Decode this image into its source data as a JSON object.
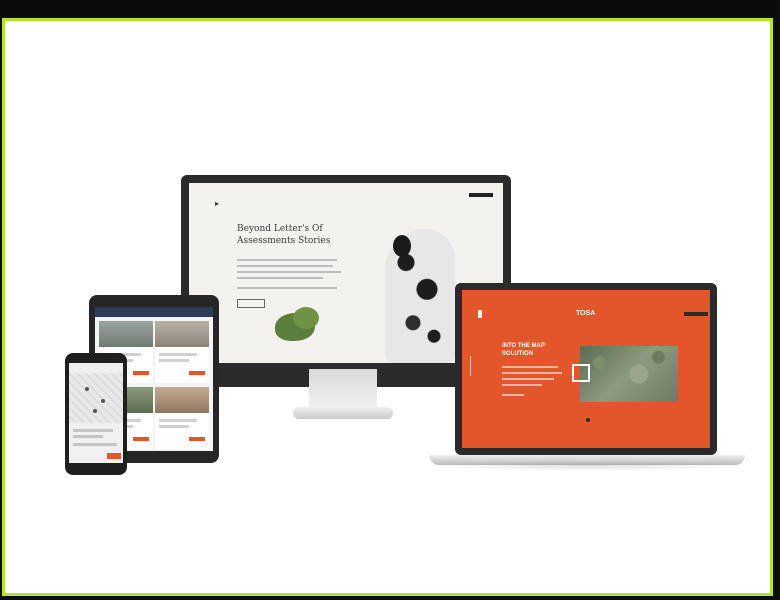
{
  "frame": {
    "border_color": "#b6e233",
    "background": "#ffffff",
    "page_background": "#0b0b0b"
  },
  "devices": {
    "monitor": {
      "headline": "Beyond Letter's Of Assessments Stories",
      "accent": "#e3562c"
    },
    "laptop": {
      "brand": "TOSA",
      "headline": "INTO THE MAP SOLUTION",
      "accent": "#e3562c"
    },
    "tablet": {
      "header_color": "#2c3e57"
    },
    "phone": {
      "button_color": "#e3562c"
    }
  },
  "icons": [
    "monitor-device-icon",
    "laptop-device-icon",
    "tablet-device-icon",
    "phone-device-icon"
  ]
}
